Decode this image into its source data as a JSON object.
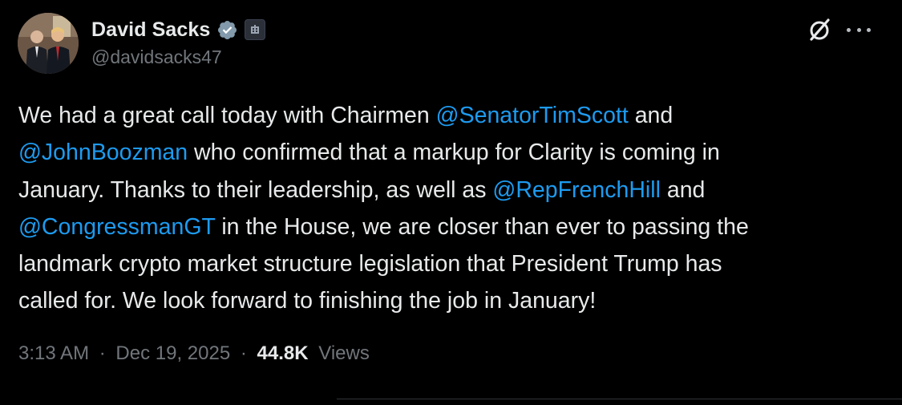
{
  "author": {
    "display_name": "David Sacks",
    "handle": "@davidsacks47"
  },
  "tweet": {
    "lines": [
      [
        {
          "text": "We had a great call today with Chairmen ",
          "mention": false
        },
        {
          "text": "@SenatorTimScott",
          "mention": true
        },
        {
          "text": " and",
          "mention": false
        }
      ],
      [
        {
          "text": "@JohnBoozman",
          "mention": true
        },
        {
          "text": " who confirmed that a markup for Clarity is coming in",
          "mention": false
        }
      ],
      [
        {
          "text": "January. Thanks to their leadership, as well as ",
          "mention": false
        },
        {
          "text": "@RepFrenchHill",
          "mention": true
        },
        {
          "text": " and",
          "mention": false
        }
      ],
      [
        {
          "text": "@CongressmanGT",
          "mention": true
        },
        {
          "text": " in the House, we are closer than ever to passing the",
          "mention": false
        }
      ],
      [
        {
          "text": "landmark crypto market structure legislation that President Trump has",
          "mention": false
        }
      ],
      [
        {
          "text": "called for. We look forward to finishing the job in January!",
          "mention": false
        }
      ]
    ]
  },
  "meta": {
    "time": "3:13 AM",
    "separator": "·",
    "date": "Dec 19, 2025",
    "views_count": "44.8K",
    "views_label": "Views"
  },
  "icons": {
    "verified": "verified-badge-icon",
    "affiliation": "government-affiliation-icon",
    "grok": "grok-icon",
    "more": "more-options-icon"
  },
  "colors": {
    "background": "#000000",
    "text": "#e7e9ea",
    "secondary": "#71767b",
    "mention": "#1d9bf0"
  }
}
